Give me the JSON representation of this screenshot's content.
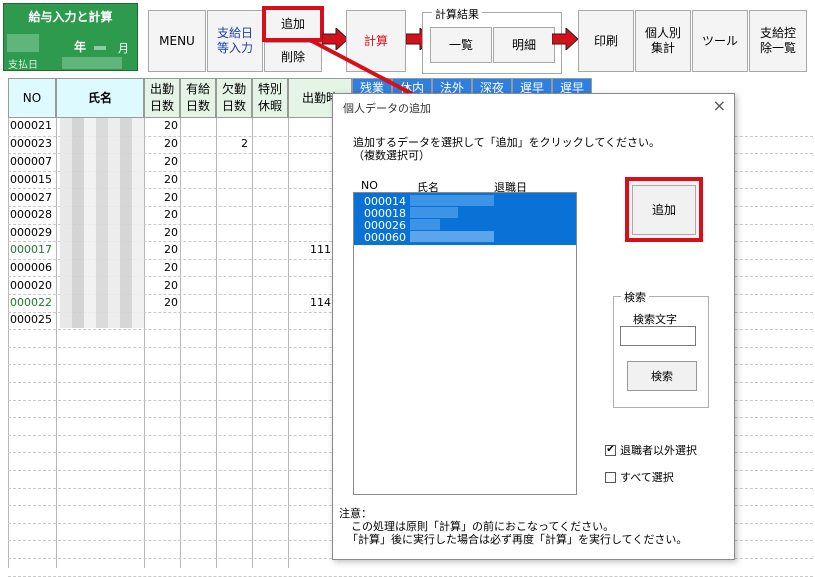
{
  "sheet": {
    "title": "給与入力と計算",
    "year_label": "年",
    "month_label": "月",
    "pay_date_label": "支払日"
  },
  "toolbar": {
    "menu": "MENU",
    "pay_date_input": "支給日\n等入力",
    "add": "追加",
    "delete": "削除",
    "calc": "計算",
    "calc_result_label": "計算結果",
    "list_view": "一覧",
    "detail_view": "明細",
    "print": "印刷",
    "per_person_total": "個人別\n集計",
    "tools": "ツール",
    "deduction_list": "支給控\n除一覧"
  },
  "grid": {
    "headers": [
      "NO",
      "氏名",
      "出勤\n日数",
      "有給\n日数",
      "欠勤\n日数",
      "特別\n休暇",
      "出勤時",
      "残業",
      "休内",
      "法外",
      "深夜",
      "遅早",
      "遅早"
    ],
    "rows": [
      {
        "no": "000021",
        "days": "20",
        "absent": "",
        "work": "",
        "green": false
      },
      {
        "no": "000023",
        "days": "20",
        "absent": "2",
        "work": "",
        "green": false
      },
      {
        "no": "000007",
        "days": "20",
        "absent": "",
        "work": "",
        "green": false
      },
      {
        "no": "000015",
        "days": "20",
        "absent": "",
        "work": "",
        "green": false
      },
      {
        "no": "000027",
        "days": "20",
        "absent": "",
        "work": "",
        "green": false
      },
      {
        "no": "000028",
        "days": "20",
        "absent": "",
        "work": "",
        "green": false
      },
      {
        "no": "000029",
        "days": "20",
        "absent": "",
        "work": "",
        "green": false
      },
      {
        "no": "000017",
        "days": "20",
        "absent": "",
        "work": "111",
        "green": true
      },
      {
        "no": "000006",
        "days": "20",
        "absent": "",
        "work": "",
        "green": false
      },
      {
        "no": "000020",
        "days": "20",
        "absent": "",
        "work": "",
        "green": false
      },
      {
        "no": "000022",
        "days": "20",
        "absent": "",
        "work": "114",
        "green": true
      },
      {
        "no": "000025",
        "days": "",
        "absent": "",
        "work": "",
        "green": false
      }
    ]
  },
  "dialog": {
    "title": "個人データの追加",
    "close": "×",
    "instruction_line1": "追加するデータを選択して「追加」をクリックしてください。",
    "instruction_line2": "（複数選択可）",
    "col_no": "NO",
    "col_name": "氏名",
    "col_retire": "退職日",
    "list_items": [
      "000014",
      "000018",
      "000026",
      "000060"
    ],
    "add_button": "追加",
    "search_group": "検索",
    "search_text_label": "検索文字",
    "search_value": "",
    "search_button": "検索",
    "exclude_retired_label": "退職者以外選択",
    "exclude_retired_checked": true,
    "select_all_label": "すべて選択",
    "select_all_checked": false,
    "note_title": "注意：",
    "note_line1": "この処理は原則「計算」の前におこなってください。",
    "note_line2": "「計算」後に実行した場合は必ず再度「計算」を実行してください。"
  },
  "colors": {
    "accent_red": "#d6101a",
    "title_green": "#2e9a4e",
    "header_green_bg": "#e4f5e6",
    "header_cyan_bg": "#dcfaff",
    "header_blue_bg": "#2f7fe0",
    "selection_blue": "#0a72d6"
  }
}
